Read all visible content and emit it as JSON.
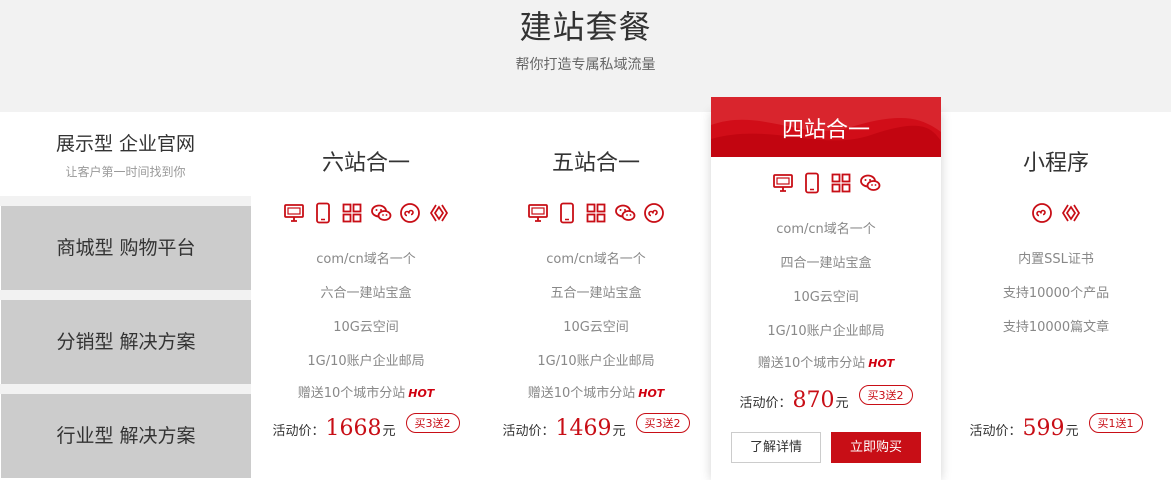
{
  "header": {
    "title": "建站套餐",
    "subtitle": "帮你打造专属私域流量"
  },
  "sidebar": {
    "first": {
      "title": "展示型 企业官网",
      "subtitle": "让客户第一时间找到你"
    },
    "items": [
      {
        "label": "商城型 购物平台"
      },
      {
        "label": "分销型 解决方案"
      },
      {
        "label": "行业型 解决方案"
      }
    ]
  },
  "accent_color": "#c80e16",
  "price_label": "活动价：",
  "currency_unit": "元",
  "hot_label": "HOT",
  "plans": [
    {
      "name": "六站合一",
      "icons": [
        "pc-icon",
        "mobile-icon",
        "apps-icon",
        "wechat-icon",
        "miniprogram-icon",
        "baidu-icon"
      ],
      "features": [
        "com/cn域名一个",
        "六合一建站宝盒",
        "10G云空间",
        "1G/10账户企业邮局",
        "赠送10个城市分站"
      ],
      "price": "1668",
      "promo": "买3送2"
    },
    {
      "name": "五站合一",
      "icons": [
        "pc-icon",
        "mobile-icon",
        "apps-icon",
        "wechat-icon",
        "miniprogram-icon"
      ],
      "features": [
        "com/cn域名一个",
        "五合一建站宝盒",
        "10G云空间",
        "1G/10账户企业邮局",
        "赠送10个城市分站"
      ],
      "price": "1469",
      "promo": "买3送2"
    },
    {
      "name": "四站合一",
      "icons": [
        "pc-icon",
        "mobile-icon",
        "apps-icon",
        "wechat-icon"
      ],
      "features": [
        "com/cn域名一个",
        "四合一建站宝盒",
        "10G云空间",
        "1G/10账户企业邮局",
        "赠送10个城市分站"
      ],
      "price": "870",
      "promo": "买3送2",
      "detail_label": "了解详情",
      "buy_label": "立即购买"
    },
    {
      "name": "小程序",
      "icons": [
        "miniprogram-icon",
        "baidu-icon"
      ],
      "features": [
        "内置SSL证书",
        "支持10000个产品",
        "支持10000篇文章"
      ],
      "price": "599",
      "promo": "买1送1"
    }
  ]
}
